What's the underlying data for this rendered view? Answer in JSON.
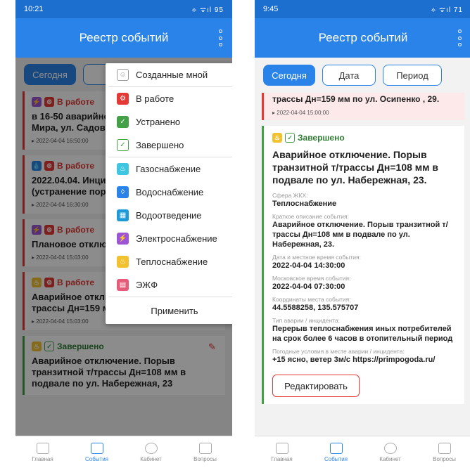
{
  "left": {
    "status": {
      "time": "10:21",
      "right": "⟡ ᯤıl 95"
    },
    "title": "Реестр событий",
    "tabs": [
      "Сегодня"
    ],
    "cards": [
      {
        "status": "В работе",
        "title": "в 16-50 аварийно снабжения (неисп Мира, ул. Садова",
        "date": "▸ 2022-04-04 16:50:00"
      },
      {
        "status": "В работе",
        "title": "2022.04.04. Инци работы на сети Х (устранение пор трубопровода)",
        "date": "▸ 2022-04-04 16:30:00"
      },
      {
        "status": "В работе",
        "title": "Плановое отключ",
        "date": "▸ 2022-04-04 15:03:00"
      },
      {
        "status": "В работе",
        "title": "Аварийное отключение. Порыв т/ трассы Дн=159 мм по ул. Осипенко , 29.",
        "date": "▸ 2022-04-04 15:03:00"
      },
      {
        "status": "Завершено",
        "title": "Аварийное отключение. Порыв транзитной т/трассы Дн=108 мм в подвале по ул. Набережная, 23",
        "date": ""
      }
    ],
    "popup": {
      "items": [
        "Созданные мной",
        "В работе",
        "Устранено",
        "Завершено",
        "Газоснабжение",
        "Водоснабжение",
        "Водоотведение",
        "Электроснабжение",
        "Теплоснабжение",
        "ЭЖФ"
      ],
      "apply": "Применить"
    }
  },
  "right": {
    "status": {
      "time": "9:45",
      "right": "⟡ ᯤıl 71"
    },
    "title": "Реестр событий",
    "tabs": [
      "Сегодня",
      "Дата",
      "Период"
    ],
    "partial": {
      "title": "трассы Дн=159 мм по ул. Осипенко , 29.",
      "date": "▸ 2022-04-04 15:00:00"
    },
    "detail": {
      "status": "Завершено",
      "title": "Аварийное отключение. Порыв транзитной т/трассы Дн=108 мм в подвале по ул. Набережная, 23.",
      "fields": [
        {
          "label": "Сфера ЖКХ:",
          "value": "Теплоснабжение"
        },
        {
          "label": "Краткое описание события:",
          "value": "Аварийное отключение. Порыв транзитной т/трассы Дн=108 мм в подвале по ул. Набережная, 23."
        },
        {
          "label": "Дата и местное время события:",
          "value": "2022-04-04 14:30:00"
        },
        {
          "label": "Московское время события:",
          "value": "2022-04-04 07:30:00"
        },
        {
          "label": "Координаты места события:",
          "value": "44.5588258, 135.575707"
        },
        {
          "label": "Тип аварии / инцидента:",
          "value": "Перерыв теплоснабжения иных потребителей на срок более 6 часов в отопительный период"
        },
        {
          "label": "Погодные условия в месте аварии / инцидента:",
          "value": "+15 ясно, ветер 3м/с https://primpogoda.ru/"
        }
      ],
      "edit": "Редактировать"
    }
  },
  "nav": [
    "Главная",
    "События",
    "Кабинет",
    "Вопросы"
  ],
  "colors": {
    "primary": "#2a83e8",
    "work": "#e53935",
    "done": "#43a047",
    "heat": "#f2c12e",
    "power": "#9c55d6"
  }
}
